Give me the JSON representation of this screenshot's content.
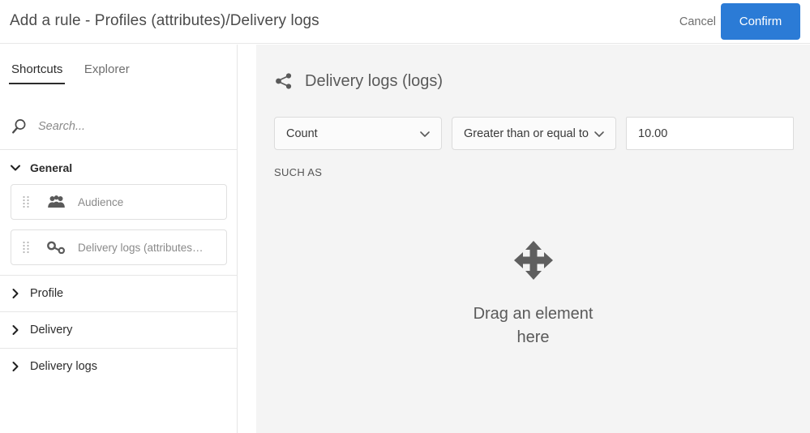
{
  "header": {
    "title": "Add a rule - Profiles (attributes)/Delivery logs",
    "cancel_label": "Cancel",
    "confirm_label": "Confirm",
    "confirm_color": "#2b7bd6"
  },
  "sidebar": {
    "tabs": [
      {
        "label": "Shortcuts",
        "active": true
      },
      {
        "label": "Explorer",
        "active": false
      }
    ],
    "search": {
      "icon": "search-icon",
      "placeholder": "Search...",
      "value": ""
    },
    "groups": [
      {
        "label": "General",
        "expanded": true,
        "chevron": "chevron-down-icon",
        "items": [
          {
            "label": "Audience",
            "icon": "audience-icon",
            "handle": "drag-handle-icon"
          },
          {
            "label": "Delivery logs (attributes…",
            "icon": "link-node-icon",
            "handle": "drag-handle-icon"
          }
        ]
      },
      {
        "label": "Profile",
        "expanded": false,
        "chevron": "chevron-right-icon",
        "items": []
      },
      {
        "label": "Delivery",
        "expanded": false,
        "chevron": "chevron-right-icon",
        "items": []
      },
      {
        "label": "Delivery logs",
        "expanded": false,
        "chevron": "chevron-right-icon",
        "items": []
      }
    ]
  },
  "main": {
    "icon": "share-nodes-icon",
    "title": "Delivery logs (logs)",
    "fields": {
      "aggregate": {
        "value": "Count",
        "chevron": "chevron-down-icon"
      },
      "operator": {
        "value": "Greater than or equal to",
        "chevron": "chevron-down-icon"
      },
      "amount": {
        "value": "10.00",
        "placeholder": ""
      }
    },
    "such_as_label": "SUCH AS",
    "dropzone": {
      "icon": "move-arrows-icon",
      "text": "Drag an element here"
    },
    "background_color": "#f4f4f4"
  }
}
